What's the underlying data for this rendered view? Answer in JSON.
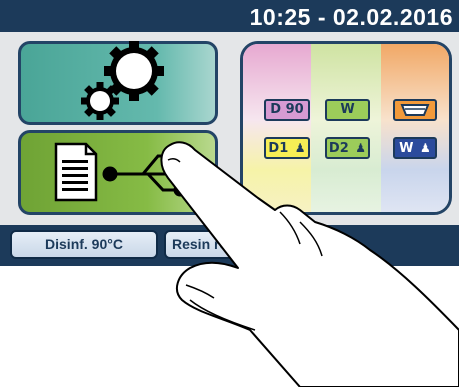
{
  "header": {
    "clock": "10:25 - 02.02.2016"
  },
  "main": {
    "settings_button": {
      "icon": "gears-icon"
    },
    "usb_button": {
      "icons": [
        "document-icon",
        "usb-icon"
      ]
    }
  },
  "programs": {
    "items": [
      {
        "label": "D 90",
        "color": "#d79bd3"
      },
      {
        "label": "W",
        "color": "#9ccc5a"
      },
      {
        "label": "",
        "icon": "tray-icon",
        "color": "#f29a3a"
      },
      {
        "label": "D1",
        "icon": "person-icon",
        "color": "#f6ee55"
      },
      {
        "label": "D2",
        "icon": "person-icon",
        "color": "#9ccc5a"
      },
      {
        "label": "W",
        "icon": "person-icon",
        "color": "#2b4b9c"
      }
    ]
  },
  "bottom_buttons": {
    "disinfection": "Disinf. 90°C",
    "resin": "Resin re"
  },
  "colors": {
    "screen_bg": "#1c3a5a",
    "panel_bg": "#e4e6e8",
    "settings_green": "#4aa597",
    "usb_green": "#86bb45"
  }
}
